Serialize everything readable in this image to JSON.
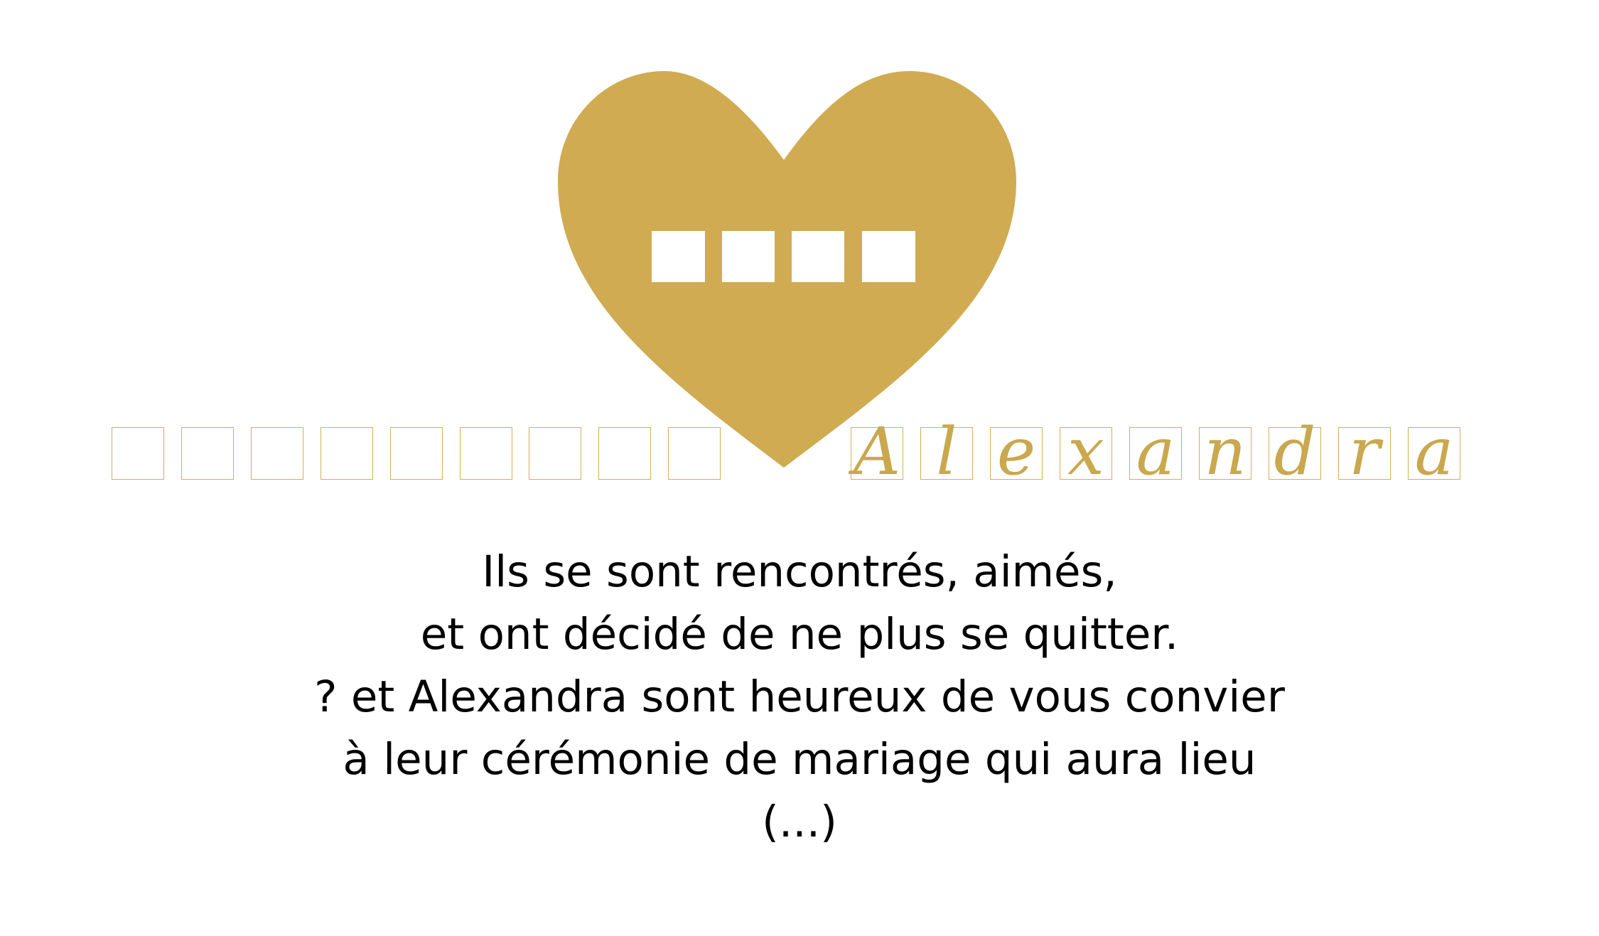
{
  "colors": {
    "accent_gold": "#d0ab52",
    "box_border": "#d4ae52",
    "name_text": "#c9a84e",
    "message_text": "#000000",
    "background": "#ffffff"
  },
  "icons": {
    "heart": "heart-icon"
  },
  "placeholder_counts": {
    "heart_squares": 4,
    "groom_name_boxes": 9
  },
  "bride_name_letters": [
    "A",
    "l",
    "e",
    "x",
    "a",
    "n",
    "d",
    "r",
    "a"
  ],
  "message_lines": [
    "Ils se sont rencontrés, aimés,",
    "et ont décidé de ne plus se quitter.",
    "? et Alexandra sont heureux de vous convier",
    "à leur cérémonie de mariage qui aura lieu",
    "(...)"
  ]
}
